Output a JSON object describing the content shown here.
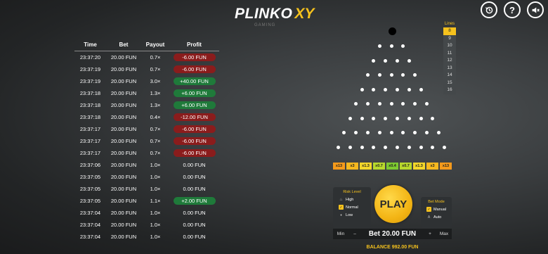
{
  "logo": {
    "main": "PLINKO",
    "accent": "XY",
    "sub": "GAMING"
  },
  "top_icons": [
    "history-icon",
    "help-icon",
    "sound-muted-icon"
  ],
  "history": {
    "headers": {
      "time": "Time",
      "bet": "Bet",
      "payout": "Payout",
      "profit": "Profit"
    },
    "rows": [
      {
        "time": "23:37:20",
        "bet": "20.00 FUN",
        "payout": "0.7×",
        "profit": "-6.00 FUN",
        "type": "loss"
      },
      {
        "time": "23:37:19",
        "bet": "20.00 FUN",
        "payout": "0.7×",
        "profit": "-6.00 FUN",
        "type": "loss"
      },
      {
        "time": "23:37:19",
        "bet": "20.00 FUN",
        "payout": "3.0×",
        "profit": "+40.00 FUN",
        "type": "win"
      },
      {
        "time": "23:37:18",
        "bet": "20.00 FUN",
        "payout": "1.3×",
        "profit": "+6.00 FUN",
        "type": "win"
      },
      {
        "time": "23:37:18",
        "bet": "20.00 FUN",
        "payout": "1.3×",
        "profit": "+6.00 FUN",
        "type": "win"
      },
      {
        "time": "23:37:18",
        "bet": "20.00 FUN",
        "payout": "0.4×",
        "profit": "-12.00 FUN",
        "type": "loss"
      },
      {
        "time": "23:37:17",
        "bet": "20.00 FUN",
        "payout": "0.7×",
        "profit": "-6.00 FUN",
        "type": "loss"
      },
      {
        "time": "23:37:17",
        "bet": "20.00 FUN",
        "payout": "0.7×",
        "profit": "-6.00 FUN",
        "type": "loss"
      },
      {
        "time": "23:37:17",
        "bet": "20.00 FUN",
        "payout": "0.7×",
        "profit": "-6.00 FUN",
        "type": "loss"
      },
      {
        "time": "23:37:06",
        "bet": "20.00 FUN",
        "payout": "1.0×",
        "profit": "0.00 FUN",
        "type": "zero"
      },
      {
        "time": "23:37:05",
        "bet": "20.00 FUN",
        "payout": "1.0×",
        "profit": "0.00 FUN",
        "type": "zero"
      },
      {
        "time": "23:37:05",
        "bet": "20.00 FUN",
        "payout": "1.0×",
        "profit": "0.00 FUN",
        "type": "zero"
      },
      {
        "time": "23:37:05",
        "bet": "20.00 FUN",
        "payout": "1.1×",
        "profit": "+2.00 FUN",
        "type": "win"
      },
      {
        "time": "23:37:04",
        "bet": "20.00 FUN",
        "payout": "1.0×",
        "profit": "0.00 FUN",
        "type": "zero"
      },
      {
        "time": "23:37:04",
        "bet": "20.00 FUN",
        "payout": "1.0×",
        "profit": "0.00 FUN",
        "type": "zero"
      },
      {
        "time": "23:37:04",
        "bet": "20.00 FUN",
        "payout": "1.0×",
        "profit": "0.00 FUN",
        "type": "zero"
      }
    ]
  },
  "board": {
    "rows": 8
  },
  "lines": {
    "title": "Lines",
    "options": [
      "8",
      "9",
      "10",
      "11",
      "12",
      "13",
      "14",
      "15",
      "16"
    ],
    "selected": "8"
  },
  "multipliers": [
    {
      "label": "x13",
      "color": "#f59a1b"
    },
    {
      "label": "x3",
      "color": "#f6b81f"
    },
    {
      "label": "x1.3",
      "color": "#f3d62a"
    },
    {
      "label": "x0.7",
      "color": "#b8d82c"
    },
    {
      "label": "x0.4",
      "color": "#7ec930"
    },
    {
      "label": "x0.7",
      "color": "#b8d82c"
    },
    {
      "label": "x1.3",
      "color": "#f3d62a"
    },
    {
      "label": "x3",
      "color": "#f6b81f"
    },
    {
      "label": "x13",
      "color": "#f59a1b"
    }
  ],
  "risk": {
    "title": "Risk Level",
    "options": [
      {
        "label": "High",
        "icon": "flame-icon",
        "active": false
      },
      {
        "label": "Normal",
        "icon": "check-icon",
        "active": true
      },
      {
        "label": "Low",
        "icon": "drop-icon",
        "active": false
      }
    ]
  },
  "play_label": "PLAY",
  "bet_mode": {
    "title": "Bet Mode",
    "options": [
      {
        "label": "Manual",
        "icon": "check-icon",
        "active": true
      },
      {
        "label": "Auto",
        "icon": "auto-icon",
        "active": false
      }
    ]
  },
  "bet": {
    "min": "Min",
    "minus": "–",
    "value": "Bet 20.00 FUN",
    "plus": "+",
    "max": "Max"
  },
  "balance": "BALANCE 992.00 FUN",
  "colors": {
    "accent": "#f6c21d",
    "win": "#1f7a3a",
    "loss": "#8a1c1c"
  }
}
